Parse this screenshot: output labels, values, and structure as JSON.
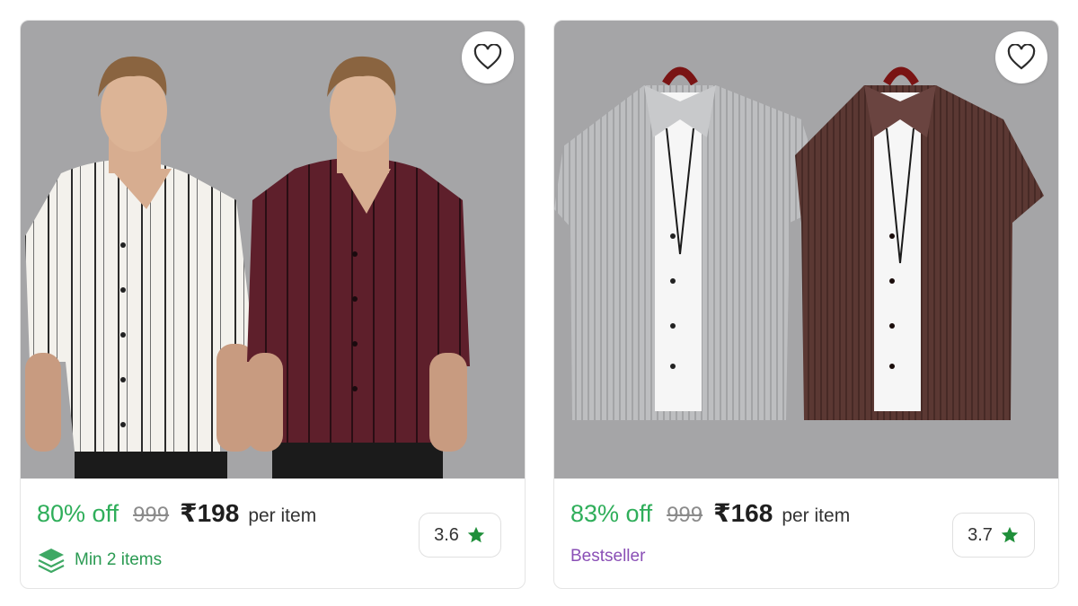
{
  "products": [
    {
      "discount": "80% off",
      "mrp": "999",
      "price": "₹198",
      "per_unit": "per item",
      "tag": "Min 2 items",
      "tag_icon": "layers-icon",
      "rating": "3.6",
      "rating_icon": "star-icon",
      "wishlist_icon": "heart-icon",
      "colors": [
        "#f3f1ec",
        "#5e1f2b"
      ]
    },
    {
      "discount": "83% off",
      "mrp": "999",
      "price": "₹168",
      "per_unit": "per item",
      "tag": "Bestseller",
      "rating": "3.7",
      "rating_icon": "star-icon",
      "wishlist_icon": "heart-icon",
      "colors": [
        "#b9babc",
        "#5b3833"
      ]
    }
  ],
  "theme": {
    "discount_color": "#2fae5a",
    "star_color": "#1f8f3a",
    "bestseller_color": "#8a4fb6",
    "photo_bg": "#a5a5a7"
  }
}
